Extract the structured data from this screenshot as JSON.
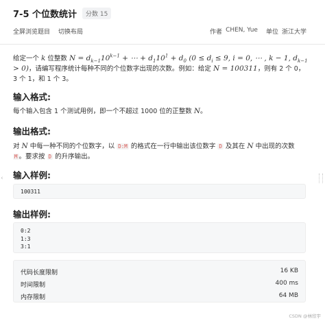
{
  "problem": {
    "title": "7-5 个位数统计",
    "score": "分数 15"
  },
  "toolbar": {
    "fullscreen": "全屏浏览题目",
    "switch_layout": "切换布局",
    "author_label": "作者",
    "author": "CHEN, Yue",
    "org_label": "单位",
    "org": "浙江大学"
  },
  "description": {
    "t1": "给定一个 ",
    "m1": "k",
    "t2": " 位整数 ",
    "t3": "，请编写程序统计每种不同的个位数字出现的次数。例如：给定 ",
    "m_n_eq": "N = 100311",
    "t4": "，则有 2 个 0，3 个 1，和 1 个 3。"
  },
  "input_format": {
    "heading": "输入格式:",
    "text_a": "每个输入包含 1 个测试用例，即一个不超过 1000 位的正整数 ",
    "text_m": "N",
    "text_b": "。"
  },
  "output_format": {
    "heading": "输出格式:",
    "t1": "对 ",
    "m1": "N",
    "t2": " 中每一种不同的个位数字，以 ",
    "c1": "D:M",
    "t3": " 的格式在一行中输出该位数字 ",
    "c2": "D",
    "t4": " 及其在 ",
    "m2": "N",
    "t5": " 中出现的次数 ",
    "c3": "M",
    "t6": "。要求按 ",
    "c4": "D",
    "t7": " 的升序输出。"
  },
  "sample_input": {
    "heading": "输入样例:",
    "lines": [
      "100311"
    ]
  },
  "sample_output": {
    "heading": "输出样例:",
    "lines": [
      "0:2",
      "1:3",
      "3:1"
    ]
  },
  "limits": [
    {
      "label": "代码长度限制",
      "value": "16 KB"
    },
    {
      "label": "时间限制",
      "value": "400 ms"
    },
    {
      "label": "内存限制",
      "value": "64 MB"
    }
  ],
  "watermark": "CSDN @林欣宇"
}
